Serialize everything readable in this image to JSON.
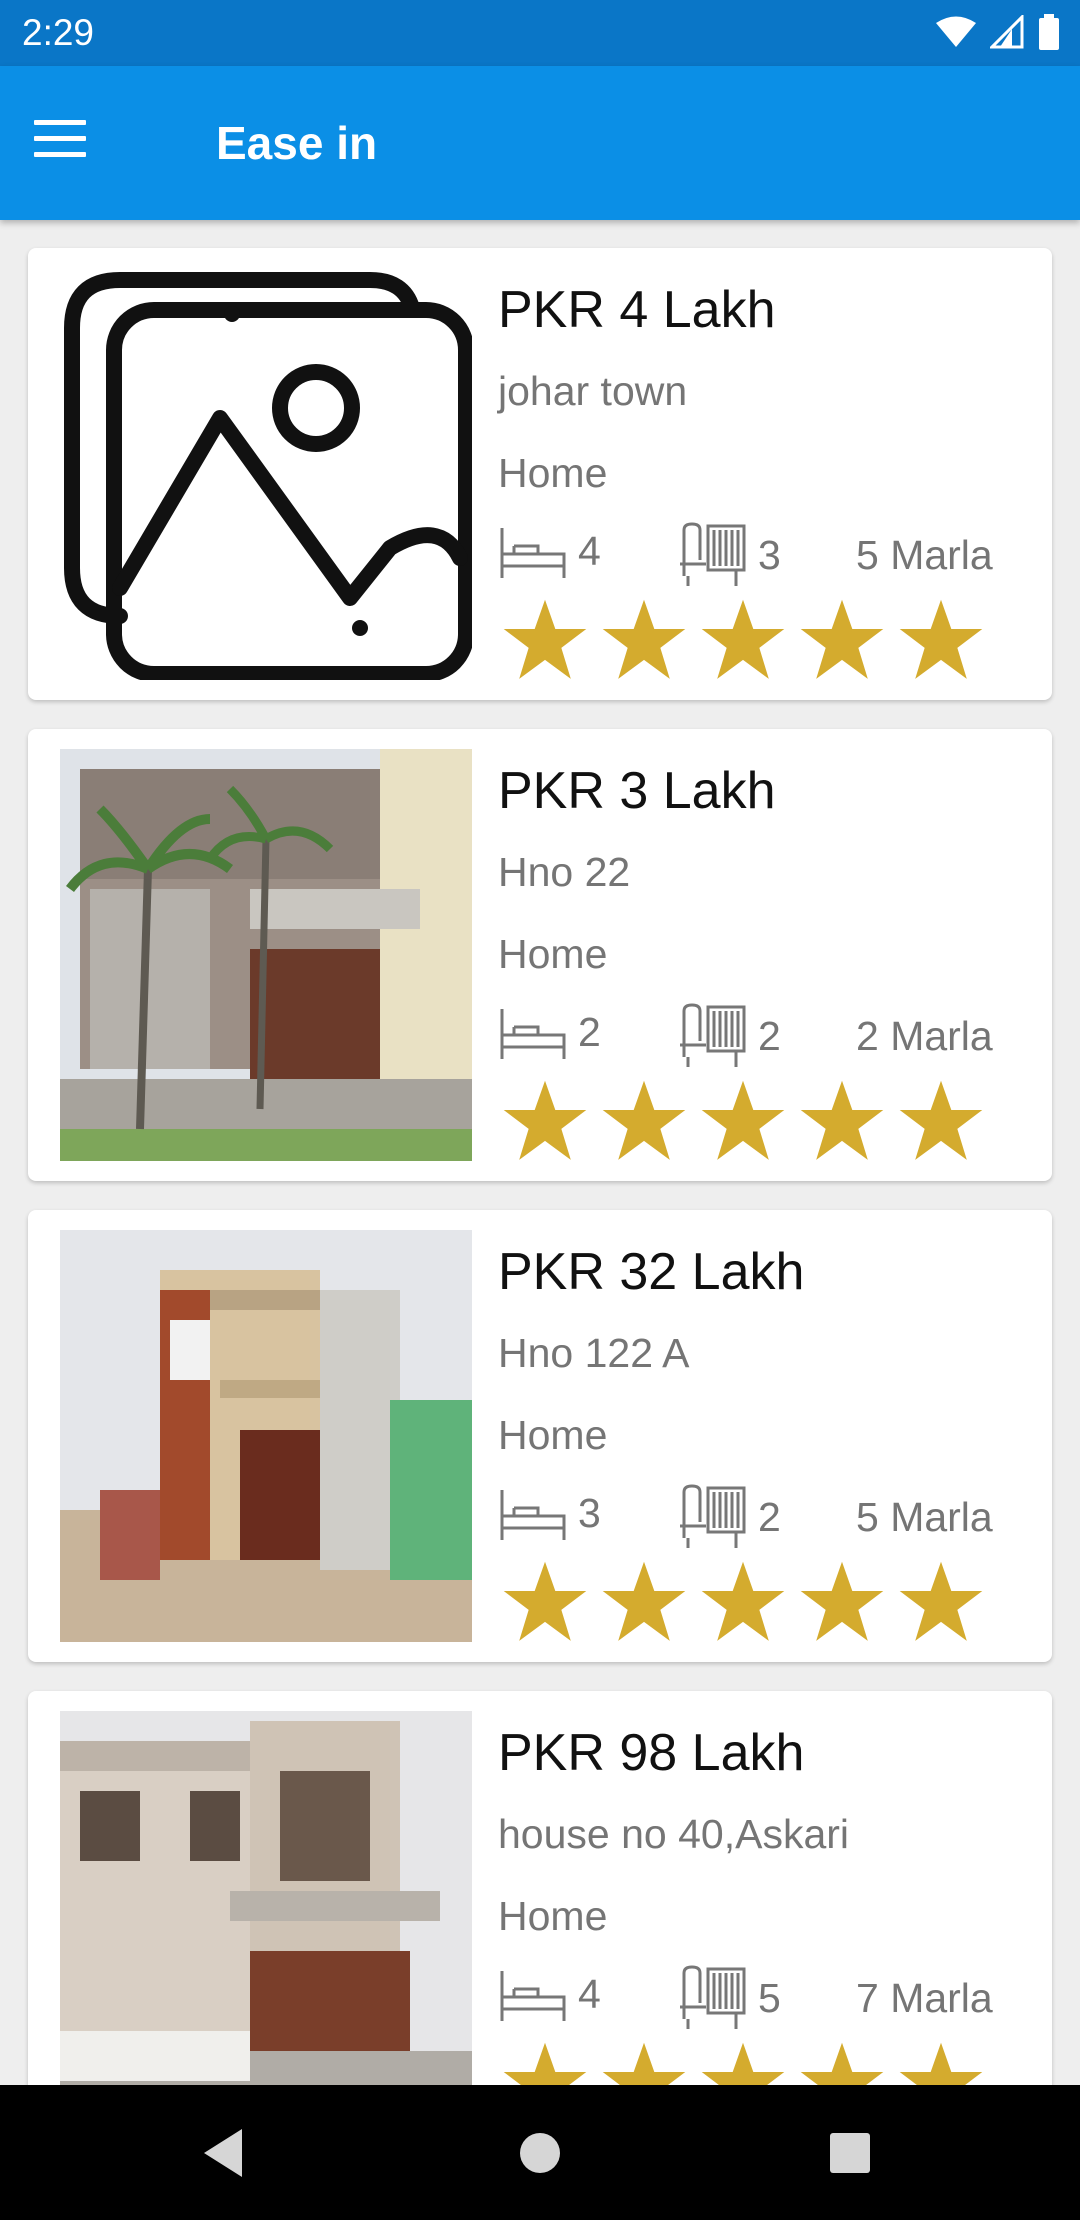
{
  "status_bar": {
    "time": "2:29"
  },
  "app_bar": {
    "title": "Ease in"
  },
  "listings": [
    {
      "price": "PKR 4 Lakh",
      "address": "johar town",
      "type": "Home",
      "beds": "4",
      "baths": "3",
      "size": "5 Marla",
      "rating": 5,
      "image": "image-placeholder-icon"
    },
    {
      "price": "PKR 3 Lakh",
      "address": "Hno 22",
      "type": "Home",
      "beds": "2",
      "baths": "2",
      "size": "2 Marla",
      "rating": 5,
      "image": "house-photo"
    },
    {
      "price": "PKR 32 Lakh",
      "address": "Hno 122 A",
      "type": "Home",
      "beds": "3",
      "baths": "2",
      "size": "5 Marla",
      "rating": 5,
      "image": "house-photo"
    },
    {
      "price": "PKR 98 Lakh",
      "address": "house no 40,Askari",
      "type": "Home",
      "beds": "4",
      "baths": "5",
      "size": "7 Marla",
      "rating": 5,
      "image": "house-photo"
    }
  ],
  "colors": {
    "status_bar": "#0a76c7",
    "app_bar": "#0b8fe6",
    "star": "#d4ab2e",
    "secondary_text": "#757575"
  }
}
